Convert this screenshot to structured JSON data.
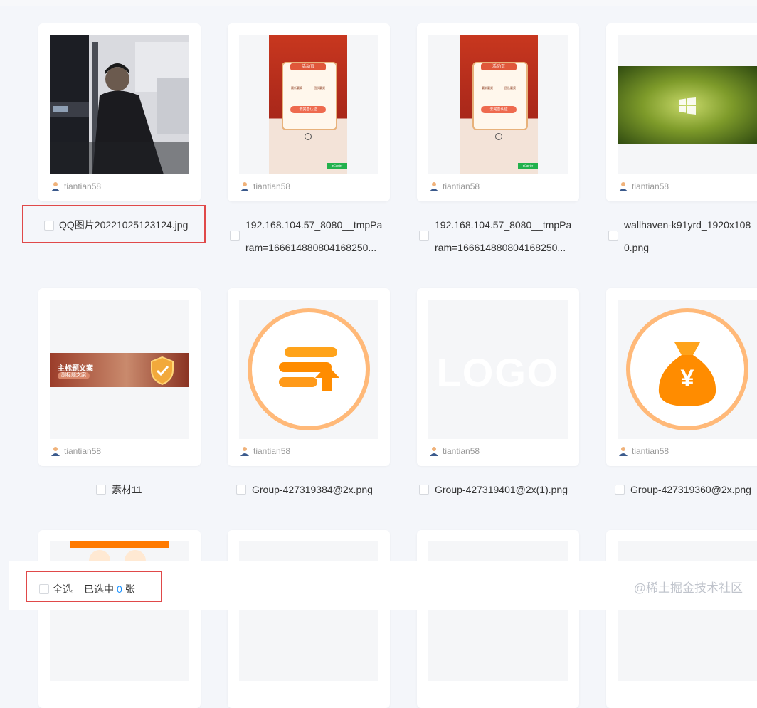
{
  "items": [
    {
      "owner": "tiantian58",
      "name": "QQ图片20221025123124.jpg",
      "name2": ""
    },
    {
      "owner": "tiantian58",
      "name": "192.168.104.57_8080__tmpPa",
      "name2": "ram=166614880804168250...",
      "thumb_text": {
        "header": "活动页",
        "left_value": "赢新赢奖",
        "right_value": "团队赢奖",
        "button": "去完善认证",
        "badge": "eCarrier"
      }
    },
    {
      "owner": "tiantian58",
      "name": "192.168.104.57_8080__tmpPa",
      "name2": "ram=166614880804168250...",
      "thumb_text": {
        "header": "活动页",
        "left_value": "赢新赢奖",
        "right_value": "团队赢奖",
        "button": "去完善认证",
        "badge": "eCarrier"
      }
    },
    {
      "owner": "tiantian58",
      "name": "wallhaven-k91yrd_1920x108",
      "name2": "0.png"
    },
    {
      "owner": "tiantian58",
      "name": "素材11",
      "name2": "",
      "thumb_text": {
        "title": "主标题文案",
        "subtitle": "副标题文案"
      }
    },
    {
      "owner": "tiantian58",
      "name": "Group-427319384@2x.png",
      "name2": ""
    },
    {
      "owner": "tiantian58",
      "name": "Group-427319401@2x(1).png",
      "name2": "",
      "thumb_text": {
        "logo": "LOGO"
      }
    },
    {
      "owner": "tiantian58",
      "name": "Group-427319360@2x.png",
      "name2": "",
      "thumb_text": {
        "currency": "¥"
      }
    }
  ],
  "footer": {
    "select_all": "全选",
    "selected_prefix": "已选中",
    "selected_count": "0",
    "selected_suffix": "张"
  },
  "watermark": "@稀土掘金技术社区",
  "colors": {
    "highlight": "#e04949",
    "accent": "#1890ff",
    "orange": "#ff9500"
  }
}
